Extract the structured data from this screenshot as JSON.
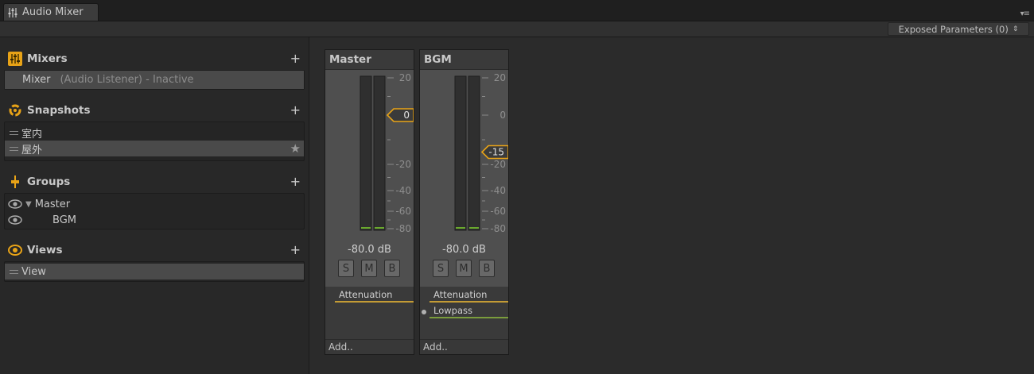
{
  "tab": {
    "title": "Audio Mixer"
  },
  "toolbar": {
    "exposed_label": "Exposed Parameters (0)"
  },
  "sidebar": {
    "mixers": {
      "title": "Mixers",
      "items": [
        {
          "name": "Mixer",
          "detail": "(Audio Listener) - Inactive"
        }
      ]
    },
    "snapshots": {
      "title": "Snapshots",
      "items": [
        {
          "name": "室内"
        },
        {
          "name": "屋外"
        }
      ]
    },
    "groups": {
      "title": "Groups",
      "items": [
        {
          "name": "Master"
        },
        {
          "name": "BGM"
        }
      ]
    },
    "views": {
      "title": "Views",
      "items": [
        {
          "name": "View"
        }
      ]
    }
  },
  "strips": [
    {
      "name": "Master",
      "attenuation_db": 0,
      "fader_label": "0",
      "db_readout": "-80.0 dB",
      "effects": [
        "Attenuation"
      ],
      "add_label": "Add.."
    },
    {
      "name": "BGM",
      "attenuation_db": -15,
      "fader_label": "-15",
      "db_readout": "-80.0 dB",
      "effects": [
        "Attenuation",
        "Lowpass"
      ],
      "add_label": "Add.."
    }
  ],
  "scale_labels": [
    "20",
    "0",
    "-20",
    "-40",
    "-60",
    "-80"
  ],
  "buttons": {
    "solo": "S",
    "mute": "M",
    "bypass": "B"
  },
  "colors": {
    "accent": "#e8a317",
    "attenuation": "#c39b35",
    "lowpass": "#7a9c3c"
  },
  "icons": {
    "tab": "mixer-sliders-icon",
    "mixers": "mixer-icon",
    "snapshots": "snapshot-cycle-icon",
    "groups": "group-fader-icon",
    "views": "eye-icon",
    "star": "star-icon"
  }
}
